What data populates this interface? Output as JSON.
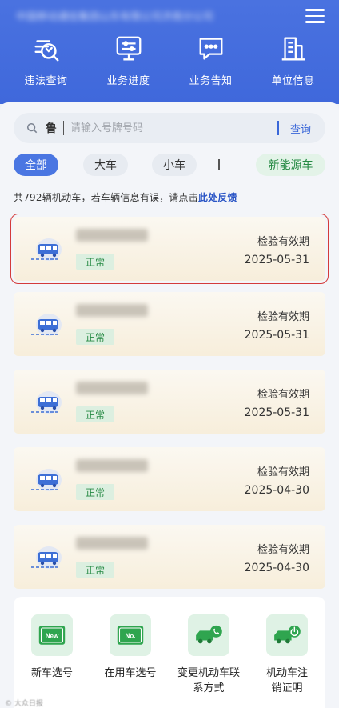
{
  "header": {
    "title": "中国移动通信集团山东有限公司济南分公司",
    "quick_nav": [
      {
        "label": "违法查询",
        "icon": "violation-query-icon"
      },
      {
        "label": "业务进度",
        "icon": "business-progress-icon"
      },
      {
        "label": "业务告知",
        "icon": "business-notice-icon"
      },
      {
        "label": "单位信息",
        "icon": "unit-info-icon"
      }
    ]
  },
  "search": {
    "prefix": "鲁",
    "placeholder": "请输入号牌号码",
    "button": "查询"
  },
  "filters": {
    "all": "全部",
    "big": "大车",
    "small": "小车",
    "ev": "新能源车"
  },
  "notice": {
    "text": "共792辆机动车，若车辆信息有误，请点击",
    "link": "此处反馈"
  },
  "vehicles": [
    {
      "status": "正常",
      "expiry_label": "检验有效期",
      "expiry_date": "2025-05-31"
    },
    {
      "status": "正常",
      "expiry_label": "检验有效期",
      "expiry_date": "2025-05-31"
    },
    {
      "status": "正常",
      "expiry_label": "检验有效期",
      "expiry_date": "2025-05-31"
    },
    {
      "status": "正常",
      "expiry_label": "检验有效期",
      "expiry_date": "2025-04-30"
    },
    {
      "status": "正常",
      "expiry_label": "检验有效期",
      "expiry_date": "2025-04-30"
    }
  ],
  "services": [
    {
      "label": "新车选号",
      "badge": "New"
    },
    {
      "label": "在用车选号",
      "badge": "No."
    },
    {
      "label": "变更机动车联系方式"
    },
    {
      "label": "机动车注销证明"
    }
  ],
  "watermark": "© 大众日报",
  "colors": {
    "header_blue": "#4a72e0",
    "accent_blue": "#3a67d8",
    "green": "#268a44",
    "selected_border": "#d43a3a"
  }
}
